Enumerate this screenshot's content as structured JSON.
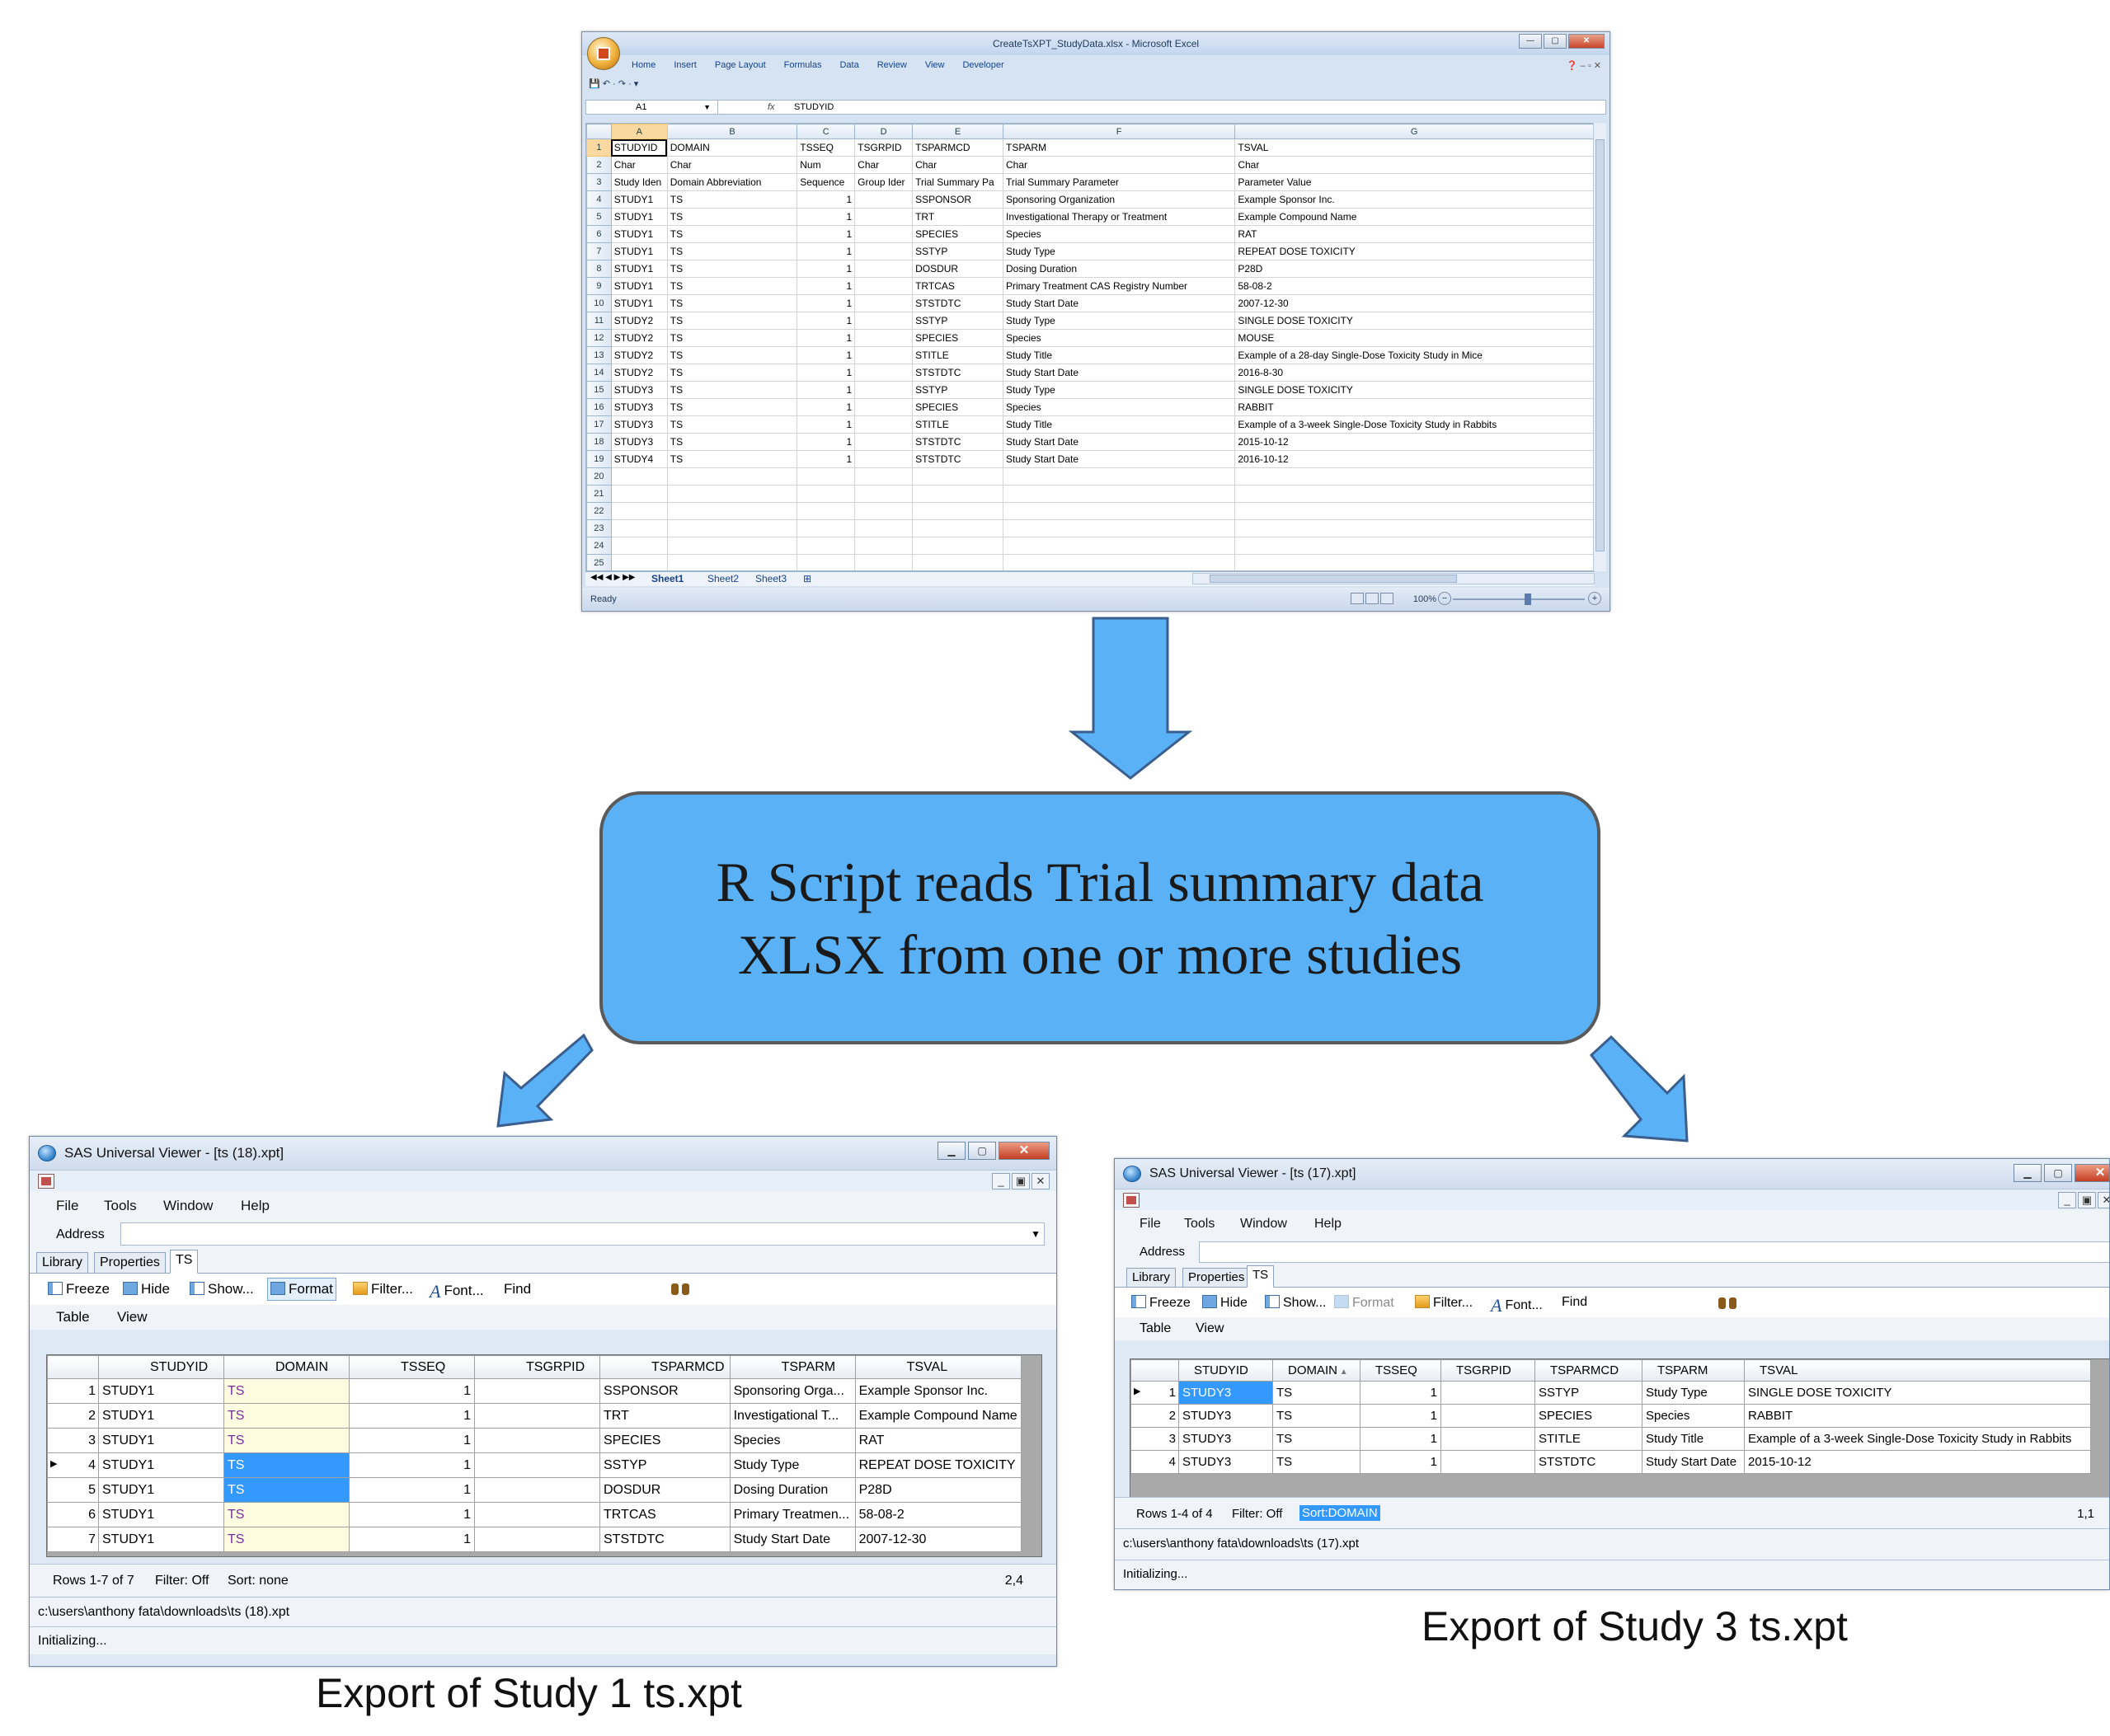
{
  "excel": {
    "title": "CreateTsXPT_StudyData.xlsx - Microsoft Excel",
    "ribbon_tabs": [
      "Home",
      "Insert",
      "Page Layout",
      "Formulas",
      "Data",
      "Review",
      "View",
      "Developer"
    ],
    "name_box": "A1",
    "formula_value": "STUDYID",
    "column_letters": [
      "A",
      "B",
      "C",
      "D",
      "E",
      "F",
      "G"
    ],
    "rows": [
      [
        "STUDYID",
        "DOMAIN",
        "TSSEQ",
        "TSGRPID",
        "TSPARMCD",
        "TSPARM",
        "TSVAL"
      ],
      [
        "Char",
        "Char",
        "Num",
        "Char",
        "Char",
        "Char",
        "Char"
      ],
      [
        "Study Iden",
        "Domain Abbreviation",
        "Sequence",
        "Group Ider",
        "Trial Summary Pa",
        "Trial Summary Parameter",
        "Parameter Value"
      ],
      [
        "STUDY1",
        "TS",
        "1",
        "",
        "SSPONSOR",
        "Sponsoring Organization",
        "Example Sponsor Inc."
      ],
      [
        "STUDY1",
        "TS",
        "1",
        "",
        "TRT",
        "Investigational Therapy or Treatment",
        "Example Compound Name"
      ],
      [
        "STUDY1",
        "TS",
        "1",
        "",
        "SPECIES",
        "Species",
        "RAT"
      ],
      [
        "STUDY1",
        "TS",
        "1",
        "",
        "SSTYP",
        "Study Type",
        "REPEAT DOSE TOXICITY"
      ],
      [
        "STUDY1",
        "TS",
        "1",
        "",
        "DOSDUR",
        "Dosing Duration",
        "P28D"
      ],
      [
        "STUDY1",
        "TS",
        "1",
        "",
        "TRTCAS",
        "Primary Treatment CAS Registry Number",
        "58-08-2"
      ],
      [
        "STUDY1",
        "TS",
        "1",
        "",
        "STSTDTC",
        "Study Start Date",
        "2007-12-30"
      ],
      [
        "STUDY2",
        "TS",
        "1",
        "",
        "SSTYP",
        "Study Type",
        "SINGLE DOSE TOXICITY"
      ],
      [
        "STUDY2",
        "TS",
        "1",
        "",
        "SPECIES",
        "Species",
        "MOUSE"
      ],
      [
        "STUDY2",
        "TS",
        "1",
        "",
        "STITLE",
        "Study Title",
        "Example of a 28-day Single-Dose Toxicity Study in Mice"
      ],
      [
        "STUDY2",
        "TS",
        "1",
        "",
        "STSTDTC",
        "Study Start Date",
        "2016-8-30"
      ],
      [
        "STUDY3",
        "TS",
        "1",
        "",
        "SSTYP",
        "Study Type",
        "SINGLE DOSE TOXICITY"
      ],
      [
        "STUDY3",
        "TS",
        "1",
        "",
        "SPECIES",
        "Species",
        "RABBIT"
      ],
      [
        "STUDY3",
        "TS",
        "1",
        "",
        "STITLE",
        "Study Title",
        "Example of a 3-week Single-Dose Toxicity Study in Rabbits"
      ],
      [
        "STUDY3",
        "TS",
        "1",
        "",
        "STSTDTC",
        "Study Start Date",
        "2015-10-12"
      ],
      [
        "STUDY4",
        "TS",
        "1",
        "",
        "STSTDTC",
        "Study Start Date",
        "2016-10-12"
      ],
      [
        "",
        "",
        "",
        "",
        "",
        "",
        ""
      ],
      [
        "",
        "",
        "",
        "",
        "",
        "",
        ""
      ],
      [
        "",
        "",
        "",
        "",
        "",
        "",
        ""
      ],
      [
        "",
        "",
        "",
        "",
        "",
        "",
        ""
      ],
      [
        "",
        "",
        "",
        "",
        "",
        "",
        ""
      ],
      [
        "",
        "",
        "",
        "",
        "",
        "",
        ""
      ]
    ],
    "sheet_tabs": [
      "Sheet1",
      "Sheet2",
      "Sheet3"
    ],
    "status": "Ready",
    "zoom": "100%"
  },
  "script_box": {
    "text": "R Script reads Trial summary data\nXLSX from one or more studies"
  },
  "viewers": [
    {
      "title": "SAS Universal Viewer - [ts (18).xpt]",
      "menu": [
        "File",
        "Tools",
        "Window",
        "Help"
      ],
      "address_label": "Address",
      "tabs": [
        "Library",
        "Properties",
        "TS"
      ],
      "toolbar": [
        "Freeze",
        "Hide",
        "Show...",
        "Format",
        "Filter...",
        "Font...",
        "Find"
      ],
      "subtoolbar": [
        "Table",
        "View"
      ],
      "columns": [
        "",
        "STUDYID",
        "DOMAIN",
        "TSSEQ",
        "TSGRPID",
        "TSPARMCD",
        "TSPARM",
        "TSVAL"
      ],
      "rows": [
        [
          "1",
          "STUDY1",
          "TS",
          "1",
          "",
          "SSPONSOR",
          "Sponsoring Orga...",
          "Example Sponsor Inc."
        ],
        [
          "2",
          "STUDY1",
          "TS",
          "1",
          "",
          "TRT",
          "Investigational T...",
          "Example Compound Name"
        ],
        [
          "3",
          "STUDY1",
          "TS",
          "1",
          "",
          "SPECIES",
          "Species",
          "RAT"
        ],
        [
          "4",
          "STUDY1",
          "TS",
          "1",
          "",
          "SSTYP",
          "Study Type",
          "REPEAT DOSE TOXICITY"
        ],
        [
          "5",
          "STUDY1",
          "TS",
          "1",
          "",
          "DOSDUR",
          "Dosing Duration",
          "P28D"
        ],
        [
          "6",
          "STUDY1",
          "TS",
          "1",
          "",
          "TRTCAS",
          "Primary Treatmen...",
          "58-08-2"
        ],
        [
          "7",
          "STUDY1",
          "TS",
          "1",
          "",
          "STSTDTC",
          "Study Start Date",
          "2007-12-30"
        ]
      ],
      "status_rows": "Rows 1-7 of 7",
      "status_filter": "Filter: Off",
      "status_sort": "Sort: none",
      "status_pos": "2,4",
      "path": "c:\\users\\anthony fata\\downloads\\ts (18).xpt",
      "init": "Initializing...",
      "caption": "Export of Study 1 ts.xpt"
    },
    {
      "title": "SAS Universal Viewer - [ts (17).xpt]",
      "menu": [
        "File",
        "Tools",
        "Window",
        "Help"
      ],
      "address_label": "Address",
      "tabs": [
        "Library",
        "Properties",
        "TS"
      ],
      "toolbar": [
        "Freeze",
        "Hide",
        "Show...",
        "Format",
        "Filter...",
        "Font...",
        "Find"
      ],
      "subtoolbar": [
        "Table",
        "View"
      ],
      "columns": [
        "",
        "STUDYID",
        "DOMAIN",
        "TSSEQ",
        "TSGRPID",
        "TSPARMCD",
        "TSPARM",
        "TSVAL"
      ],
      "rows": [
        [
          "1",
          "STUDY3",
          "TS",
          "1",
          "",
          "SSTYP",
          "Study Type",
          "SINGLE DOSE TOXICITY"
        ],
        [
          "2",
          "STUDY3",
          "TS",
          "1",
          "",
          "SPECIES",
          "Species",
          "RABBIT"
        ],
        [
          "3",
          "STUDY3",
          "TS",
          "1",
          "",
          "STITLE",
          "Study Title",
          "Example of a 3-week Single-Dose Toxicity Study in Rabbits"
        ],
        [
          "4",
          "STUDY3",
          "TS",
          "1",
          "",
          "STSTDTC",
          "Study Start Date",
          "2015-10-12"
        ]
      ],
      "status_rows": "Rows 1-4 of 4",
      "status_filter": "Filter: Off",
      "status_sort": "Sort:DOMAIN",
      "status_pos": "1,1",
      "path": "c:\\users\\anthony fata\\downloads\\ts (17).xpt",
      "init": "Initializing...",
      "caption": "Export of Study 3 ts.xpt"
    }
  ],
  "colors": {
    "script_box_fill": "#5ab1f6",
    "arrow_fill": "#5ab1f6",
    "arrow_stroke": "#3a5f8f",
    "selection_blue": "#3399ff"
  }
}
